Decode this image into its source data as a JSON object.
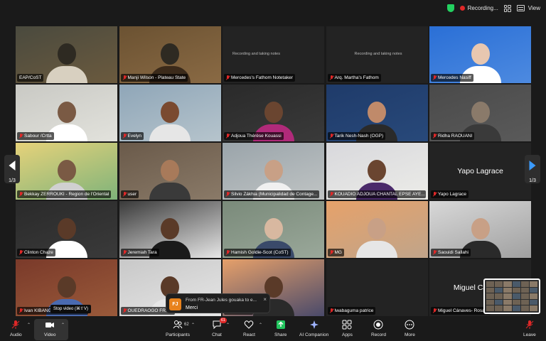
{
  "topbar": {
    "recording_label": "Recording...",
    "view_label": "View"
  },
  "tiles": [
    {
      "name": "EAP/CoST",
      "muted": false,
      "active": true,
      "caption": ""
    },
    {
      "name": "Manji Wilson - Plateau State",
      "muted": true,
      "caption": ""
    },
    {
      "name": "Mercedes's Fathom Notetaker",
      "muted": true,
      "caption": "Recording and taking notes"
    },
    {
      "name": "Arq. Martha's Fathom",
      "muted": true,
      "caption": "Recording and taking notes"
    },
    {
      "name": "Mercedes Nasiff",
      "muted": true,
      "caption": ""
    },
    {
      "name": "Sabour /Crtta",
      "muted": true,
      "caption": ""
    },
    {
      "name": "Evelyn",
      "muted": true,
      "caption": ""
    },
    {
      "name": "Adjoua Thérèse Kouassi",
      "muted": true,
      "caption": ""
    },
    {
      "name": "Tarik Nesh-Nash (OGP)",
      "muted": true,
      "caption": ""
    },
    {
      "name": "Ridha  RAOUANI",
      "muted": true,
      "caption": ""
    },
    {
      "name": "Bekkay ZERROUKI - Region de l'Oriental",
      "muted": true,
      "caption": ""
    },
    {
      "name": "user",
      "muted": true,
      "caption": ""
    },
    {
      "name": "Silvio Zákhia (Municipalidad de Contage...",
      "muted": true,
      "caption": ""
    },
    {
      "name": "KOUADIO ADJOUA CHANTAL EPSE AYE...",
      "muted": true,
      "caption": ""
    },
    {
      "name": "Yapo Lagrace",
      "muted": true,
      "caption": "",
      "big_name": "Yapo Lagrace"
    },
    {
      "name": "Clinton Chaze",
      "muted": true,
      "caption": ""
    },
    {
      "name": "Jeremiah Tara",
      "muted": true,
      "caption": ""
    },
    {
      "name": "Hamish Goldie-Scot (CoST)",
      "muted": true,
      "caption": ""
    },
    {
      "name": "MG",
      "muted": true,
      "caption": ""
    },
    {
      "name": "Saouidi Sallahi",
      "muted": true,
      "caption": ""
    },
    {
      "name": "Ivan KIBANGOU...Brazzavill...",
      "muted": true,
      "caption": ""
    },
    {
      "name": "OUEDRAOGO FRA...",
      "muted": true,
      "caption": ""
    },
    {
      "name": "...h(OGP)",
      "muted": true,
      "caption": ""
    },
    {
      "name": "Iwabaguma patrice",
      "muted": true,
      "caption": ""
    },
    {
      "name": "Miguel Cánaves- Rosa...",
      "muted": true,
      "caption": "",
      "big_name": "Miguel Cánaves"
    }
  ],
  "paging": {
    "left_label": "1/3",
    "right_label": "1/3"
  },
  "chat_toast": {
    "avatar_initials": "FJ",
    "from": "From FR-Jean Jules gouaka to e...",
    "message": "Merci",
    "close": "×"
  },
  "toolbar": {
    "audio": "Audio",
    "video": "Video",
    "video_tooltip": "Stop video (⌘⇧V)",
    "participants": "Participants",
    "participants_count": "62",
    "chat": "Chat",
    "chat_badge": "61",
    "react": "React",
    "share": "Share",
    "ai_companion": "AI Companion",
    "apps": "Apps",
    "record": "Record",
    "more": "More",
    "leave": "Leave"
  },
  "colors": {
    "active_speaker": "#36b24a",
    "muted_mic": "#e02828",
    "share_green": "#22c55e",
    "leave_red": "#e02828"
  }
}
